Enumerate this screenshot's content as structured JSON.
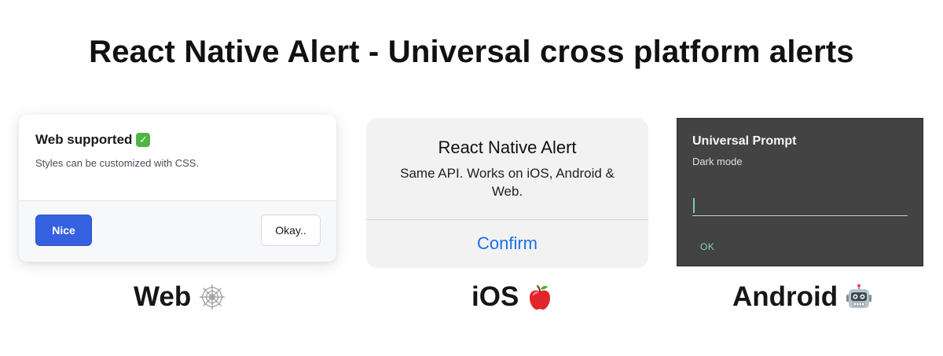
{
  "title": "React Native Alert - Universal cross platform alerts",
  "web_alert": {
    "title": "Web supported",
    "title_icon": "check-mark-button-icon",
    "message": "Styles can be customized with CSS.",
    "primary_button": "Nice",
    "secondary_button": "Okay..",
    "accent_color": "#3461e0"
  },
  "ios_alert": {
    "title": "React Native Alert",
    "message": "Same API. Works on iOS, Android & Web.",
    "confirm_button": "Confirm",
    "accent_color": "#1a6fe8"
  },
  "android_alert": {
    "title": "Universal Prompt",
    "message": "Dark mode",
    "input_value": "",
    "ok_button": "OK",
    "accent_color": "#86cfc8"
  },
  "platform_labels": [
    {
      "label": "Web",
      "icon": "spider-web-icon"
    },
    {
      "label": "iOS",
      "icon": "red-apple-icon"
    },
    {
      "label": "Android",
      "icon": "robot-icon"
    }
  ]
}
